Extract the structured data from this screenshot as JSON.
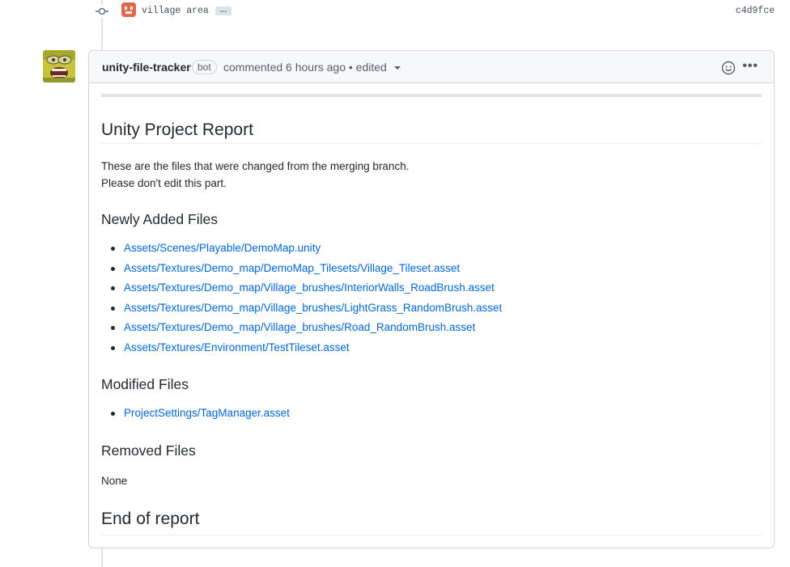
{
  "commit": {
    "message": "village area",
    "more_label": "…",
    "sha": "c4d9fce"
  },
  "comment": {
    "author": "unity-file-tracker",
    "badge": "bot",
    "meta": "commented 6 hours ago • edited",
    "more_label": "•••"
  },
  "report": {
    "title": "Unity Project Report",
    "intro_line1": "These are the files that were changed from the merging branch.",
    "intro_line2": "Please don't edit this part.",
    "added_heading": "Newly Added Files",
    "added_files": [
      "Assets/Scenes/Playable/DemoMap.unity",
      "Assets/Textures/Demo_map/DemoMap_Tilesets/Village_Tileset.asset",
      "Assets/Textures/Demo_map/Village_brushes/InteriorWalls_RoadBrush.asset",
      "Assets/Textures/Demo_map/Village_brushes/LightGrass_RandomBrush.asset",
      "Assets/Textures/Demo_map/Village_brushes/Road_RandomBrush.asset",
      "Assets/Textures/Environment/TestTileset.asset"
    ],
    "modified_heading": "Modified Files",
    "modified_files": [
      "ProjectSettings/TagManager.asset"
    ],
    "removed_heading": "Removed Files",
    "removed_text": "None",
    "end_heading": "End of report"
  },
  "colors": {
    "link": "#0366d6",
    "text": "#24292e",
    "muted": "#586069",
    "border": "#d1d5da",
    "header_bg": "#f6f8fa"
  },
  "icons": {
    "commit": "git-commit-icon",
    "emoji": "smiley-icon",
    "more": "kebab-horizontal-icon"
  }
}
